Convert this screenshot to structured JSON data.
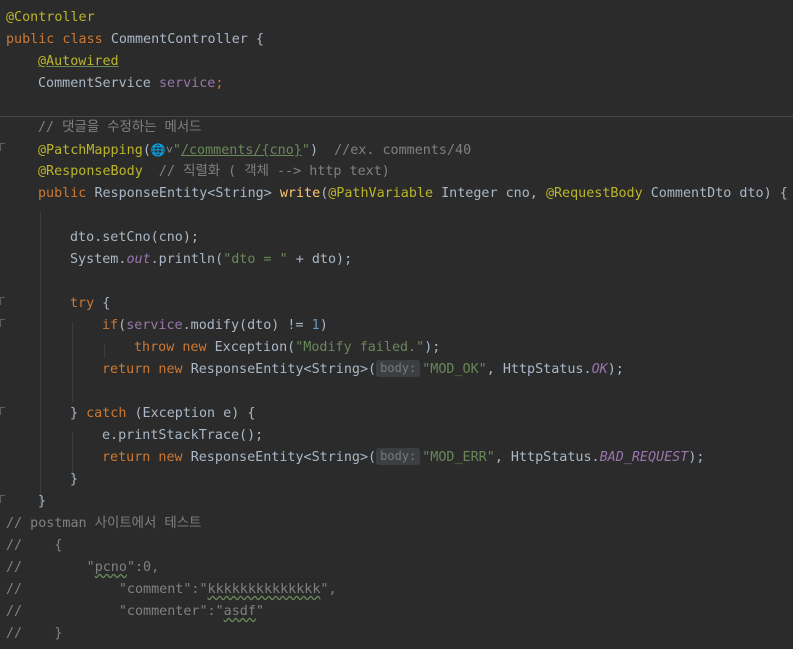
{
  "code": {
    "controller_annotation": "@Controller",
    "class_kw": "public class ",
    "class_name": "CommentController {",
    "autowired": "@Autowired",
    "service_type": "CommentService ",
    "service_field": "service",
    "semicolon": ";",
    "method_comment": "// 댓글을 수정하는 메서드",
    "patch_mapping": "@PatchMapping",
    "paren_open": "(",
    "globe_icon": "🌐˅",
    "mapping_q1": "\"",
    "mapping_path": "/comments/{cno}",
    "mapping_q2": "\"",
    "paren_close": ")  ",
    "mapping_comment": "//ex. comments/40",
    "response_body": "@ResponseBody",
    "response_comment": "  // 직렬화 ( 객체 --> http text)",
    "public_kw": "public ",
    "return_type": "ResponseEntity<String> ",
    "method_name": "write",
    "path_variable": "@PathVariable",
    "param1": " Integer cno, ",
    "request_body": "@RequestBody",
    "param2": " CommentDto dto) {",
    "set_cno": "dto.setCno(cno);",
    "sysout_pre": "System.",
    "sysout_out": "out",
    "sysout_mid": ".println(",
    "sysout_str": "\"dto = \"",
    "sysout_end": " + dto);",
    "try_kw": "try",
    "try_brace": " {",
    "if_kw": "if",
    "if_open": "(",
    "if_service": "service",
    "if_call": ".modify(dto) != ",
    "if_one": "1",
    "if_close": ")",
    "throw_kw": "throw new ",
    "exception_call": "Exception(",
    "exception_msg": "\"Modify failed.\"",
    "exception_end": ");",
    "return_new": "return new ",
    "response_entity": "ResponseEntity<String>(",
    "body_hint": "body:",
    "mod_ok": "\"MOD_OK\"",
    "http_status": ", HttpStatus.",
    "ok_const": "OK",
    "stmt_end": ");",
    "catch_close": "} ",
    "catch_kw": "catch",
    "catch_rest": " (Exception e) {",
    "print_stack": "e.printStackTrace();",
    "mod_err": "\"MOD_ERR\"",
    "bad_request": "BAD_REQUEST",
    "close_brace": "}",
    "postman_comment": "// postman 사이트에서 테스트",
    "c_open_brace": "//    {",
    "c_pcno_pre": "//        \"",
    "c_pcno_key": "pcno",
    "c_pcno_post": "\":0,",
    "c_comment_pre": "//            \"comment\":\"",
    "c_comment_val": "kkkkkkkkkkkkkk",
    "c_comment_post": "\",",
    "c_commenter_pre": "//            \"commenter\":\"",
    "c_commenter_val": "asdf",
    "c_commenter_post": "\"",
    "c_close_brace": "//    }"
  },
  "colors": {
    "background": "#2b2b2b",
    "keyword": "#cc7832",
    "annotation": "#bbb529",
    "string": "#6a8759",
    "comment": "#808080",
    "field": "#9876aa",
    "method": "#ffc66d",
    "number": "#6897bb",
    "plain": "#a9b7c6"
  }
}
